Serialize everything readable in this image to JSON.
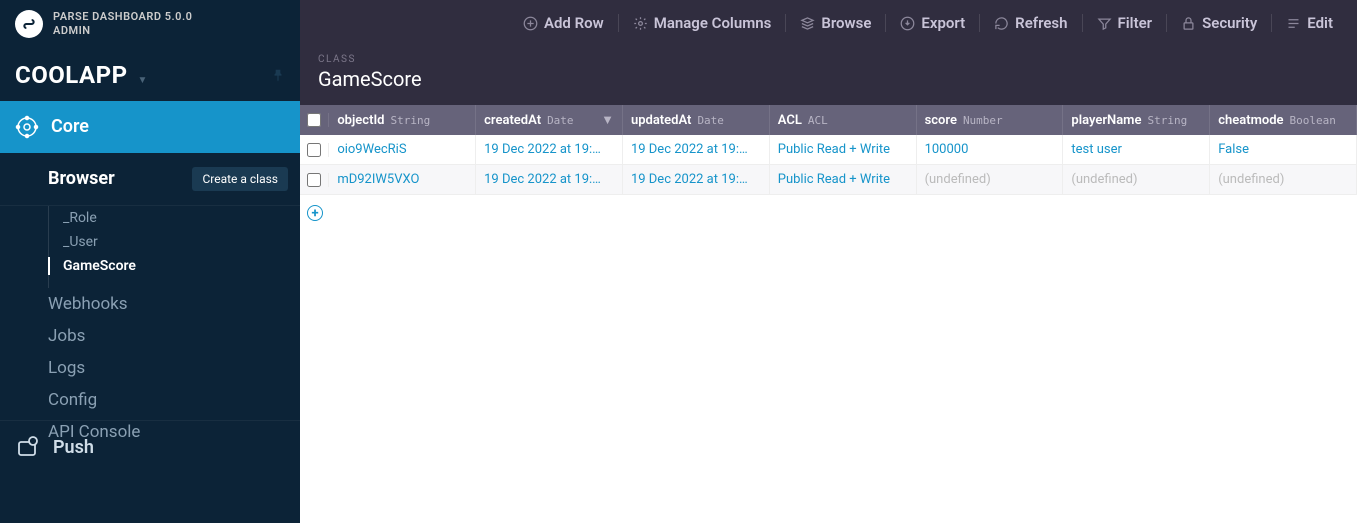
{
  "product": {
    "name": "PARSE DASHBOARD 5.0.0",
    "user": "ADMIN"
  },
  "app": {
    "name": "COOLAPP"
  },
  "sidebar": {
    "core_label": "Core",
    "browser_label": "Browser",
    "create_class_label": "Create a class",
    "classes": [
      {
        "name": "_Role"
      },
      {
        "name": "_User"
      },
      {
        "name": "GameScore"
      }
    ],
    "nav": [
      {
        "label": "Webhooks"
      },
      {
        "label": "Jobs"
      },
      {
        "label": "Logs"
      },
      {
        "label": "Config"
      },
      {
        "label": "API Console"
      }
    ],
    "push_label": "Push"
  },
  "toolbar": {
    "items": [
      {
        "label": "Add Row"
      },
      {
        "label": "Manage Columns"
      },
      {
        "label": "Browse"
      },
      {
        "label": "Export"
      },
      {
        "label": "Refresh"
      },
      {
        "label": "Filter"
      },
      {
        "label": "Security"
      },
      {
        "label": "Edit"
      }
    ]
  },
  "title": {
    "kicker": "CLASS",
    "name": "GameScore"
  },
  "columns": [
    {
      "name": "objectId",
      "type": "String"
    },
    {
      "name": "createdAt",
      "type": "Date"
    },
    {
      "name": "updatedAt",
      "type": "Date"
    },
    {
      "name": "ACL",
      "type": "ACL"
    },
    {
      "name": "score",
      "type": "Number"
    },
    {
      "name": "playerName",
      "type": "String"
    },
    {
      "name": "cheatmode",
      "type": "Boolean"
    }
  ],
  "rows": [
    {
      "objectId": "oio9WecRiS",
      "createdAt": "19 Dec 2022 at 19:…",
      "updatedAt": "19 Dec 2022 at 19:…",
      "acl": "Public Read + Write",
      "score": "100000",
      "playerName": "test user",
      "cheatmode": "False"
    },
    {
      "objectId": "mD92IW5VXO",
      "createdAt": "19 Dec 2022 at 19:…",
      "updatedAt": "19 Dec 2022 at 19:…",
      "acl": "Public Read + Write",
      "score": "(undefined)",
      "playerName": "(undefined)",
      "cheatmode": "(undefined)"
    }
  ]
}
